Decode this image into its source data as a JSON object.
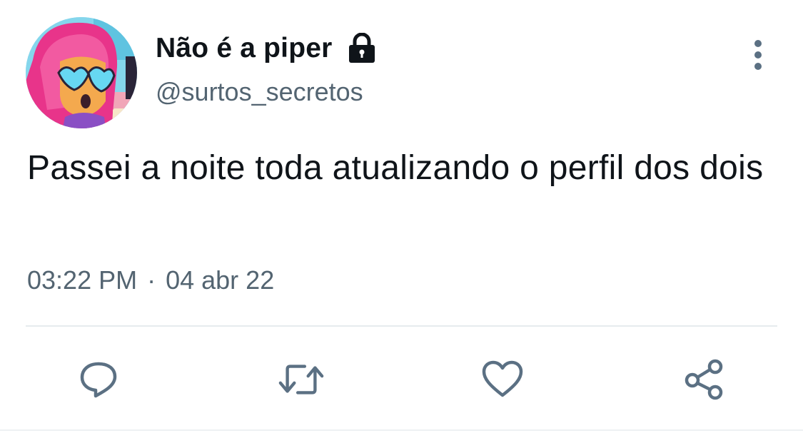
{
  "author": {
    "display_name": "Não é a piper",
    "handle": "@surtos_secretos",
    "protected_account_icon": "lock-icon",
    "avatar_description_icon": "cartoon-avatar"
  },
  "tweet": {
    "text": "Passei a noite toda atualizando o perfil dos dois",
    "time": "03:22 PM",
    "separator": "·",
    "date": "04 abr 22"
  },
  "actions": [
    {
      "name": "reply",
      "icon": "reply-icon"
    },
    {
      "name": "retweet",
      "icon": "retweet-icon"
    },
    {
      "name": "like",
      "icon": "heart-icon"
    },
    {
      "name": "share",
      "icon": "share-icon"
    }
  ],
  "menu": {
    "icon": "more-vertical-icon"
  },
  "colors": {
    "text_primary": "#0f1419",
    "text_secondary": "#536471",
    "icon_gray": "#5b7083",
    "divider": "#e6ebee"
  }
}
